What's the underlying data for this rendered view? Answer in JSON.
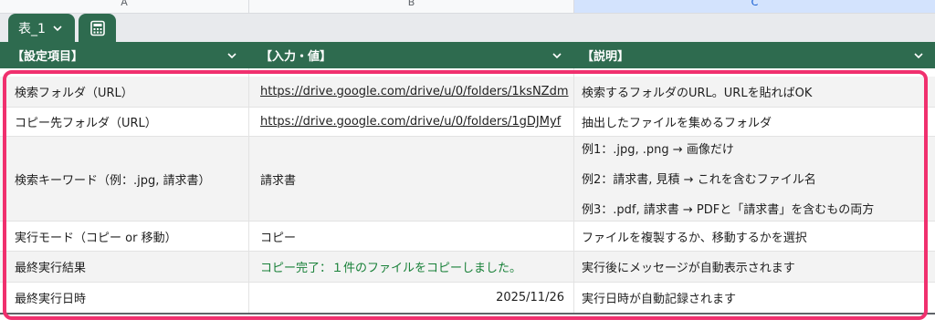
{
  "columns": {
    "a": "A",
    "b": "B",
    "c": "C"
  },
  "table_tab": {
    "name": "表_1"
  },
  "headers": [
    "【設定項目】",
    "【入力・値】",
    "【説明】"
  ],
  "rows": [
    {
      "item": "検索フォルダ（URL）",
      "value": "https://drive.google.com/drive/u/0/folders/1ksNZdm",
      "desc": "検索するフォルダのURL。URLを貼ればOK"
    },
    {
      "item": "コピー先フォルダ（URL）",
      "value": "https://drive.google.com/drive/u/0/folders/1gDJMyf",
      "desc": "抽出したファイルを集めるフォルダ"
    },
    {
      "item": "検索キーワード（例：.jpg, 請求書）",
      "value": "請求書",
      "desc_lines": [
        "例1：.jpg, .png → 画像だけ",
        "例2：請求書, 見積 → これを含むファイル名",
        "例3：.pdf, 請求書 → PDFと「請求書」を含むもの両方"
      ]
    },
    {
      "item": "実行モード（コピー or 移動）",
      "value": "コピー",
      "desc": "ファイルを複製するか、移動するかを選択"
    },
    {
      "item": "最終実行結果",
      "value": "コピー完了：１件のファイルをコピーしました。",
      "desc": "実行後にメッセージが自動表示されます"
    },
    {
      "item": "最終実行日時",
      "value": "2025/11/26",
      "desc": "実行日時が自動記録されます"
    }
  ],
  "colors": {
    "header_green": "#2e6b4f",
    "result_green": "#188038",
    "highlight": "#f0306e"
  }
}
